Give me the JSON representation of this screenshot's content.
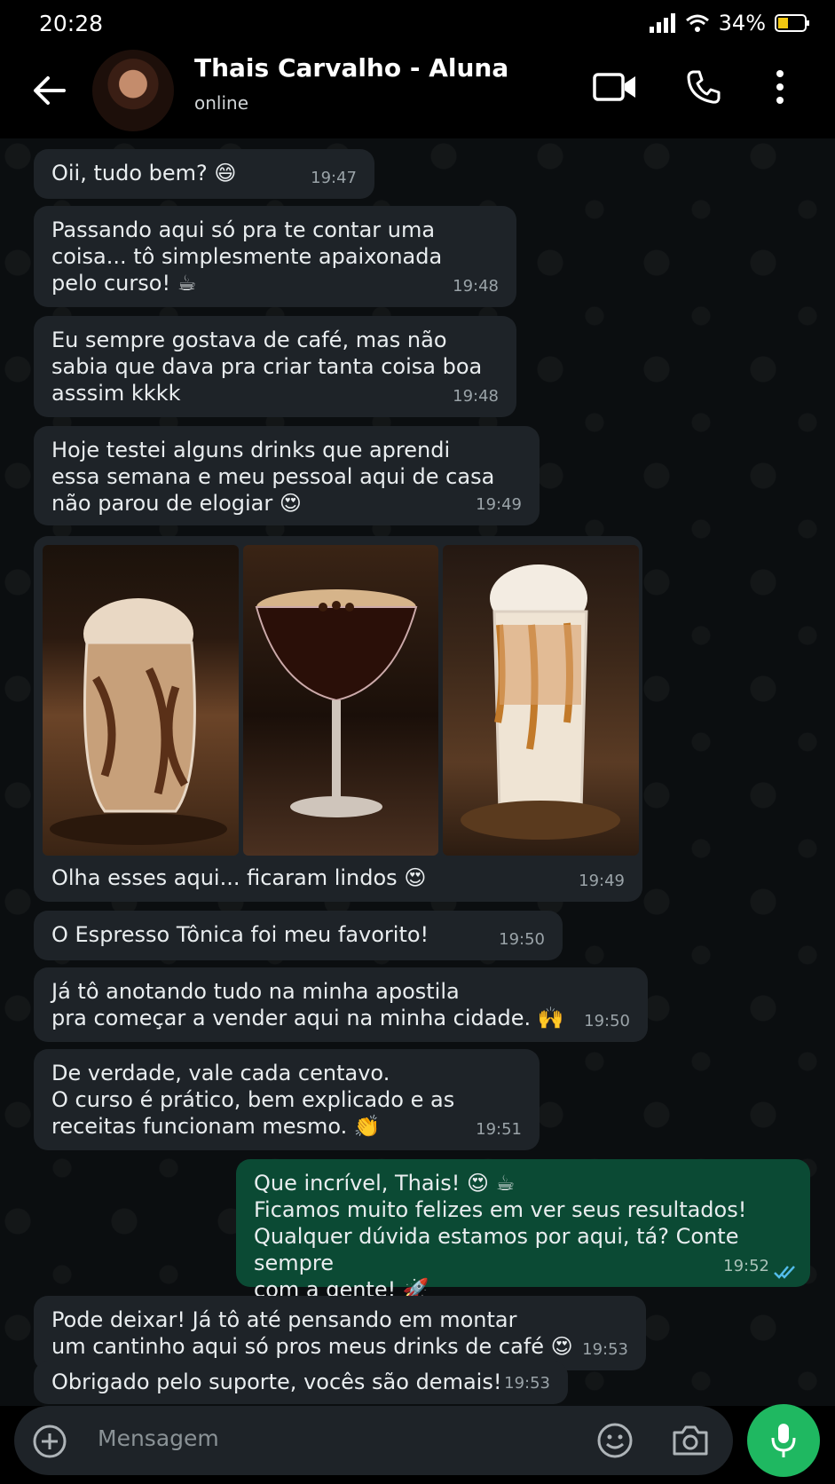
{
  "status_bar": {
    "time": "20:28",
    "battery": "34%"
  },
  "header": {
    "contact_name": "Thais Carvalho - Aluna",
    "status": "online"
  },
  "messages": [
    {
      "text": "Oii, tudo bem? 😄",
      "time": "19:47"
    },
    {
      "text": "Passando aqui só pra te contar uma\ncoisa... tô simplesmente apaixonada\npelo curso! ☕",
      "time": "19:48"
    },
    {
      "text": "Eu sempre gostava de café, mas não\nsabia que dava pra criar tanta coisa boa\nasssim kkkk",
      "time": "19:48"
    },
    {
      "text": "Hoje testei alguns drinks que aprendi\nessa semana e meu pessoal aqui de casa\nnão parou de elogiar 😍",
      "time": "19:49"
    },
    {
      "text": "Olha esses aqui... ficaram lindos 😍",
      "time": "19:49"
    },
    {
      "text": "O Espresso Tônica foi meu favorito!",
      "time": "19:50"
    },
    {
      "text": "Já tô anotando tudo na minha apostila\npra começar a vender aqui na minha cidade. 🙌",
      "time": "19:50"
    },
    {
      "text": "De verdade, vale cada centavo.\nO curso é prático, bem explicado e as\nreceitas funcionam mesmo. 👏",
      "time": "19:51"
    },
    {
      "text": "Que incrível, Thais! 😍 ☕\nFicamos muito felizes em ver seus resultados!\nQualquer dúvida estamos por aqui, tá? Conte sempre\ncom a gente! 🚀",
      "time": "19:52"
    },
    {
      "text": "Pode deixar! Já tô até pensando em montar\num cantinho aqui só pros meus drinks de café 😍",
      "time": "19:53"
    },
    {
      "text": "Obrigado pelo suporte, vocês são demais!",
      "time": "19:53"
    }
  ],
  "composer": {
    "placeholder": "Mensagem"
  },
  "colors": {
    "incoming_bubble": "#1e2328",
    "outgoing_bubble": "#0b4a34",
    "accent": "#1fb861",
    "read_ticks": "#53bdeb"
  }
}
